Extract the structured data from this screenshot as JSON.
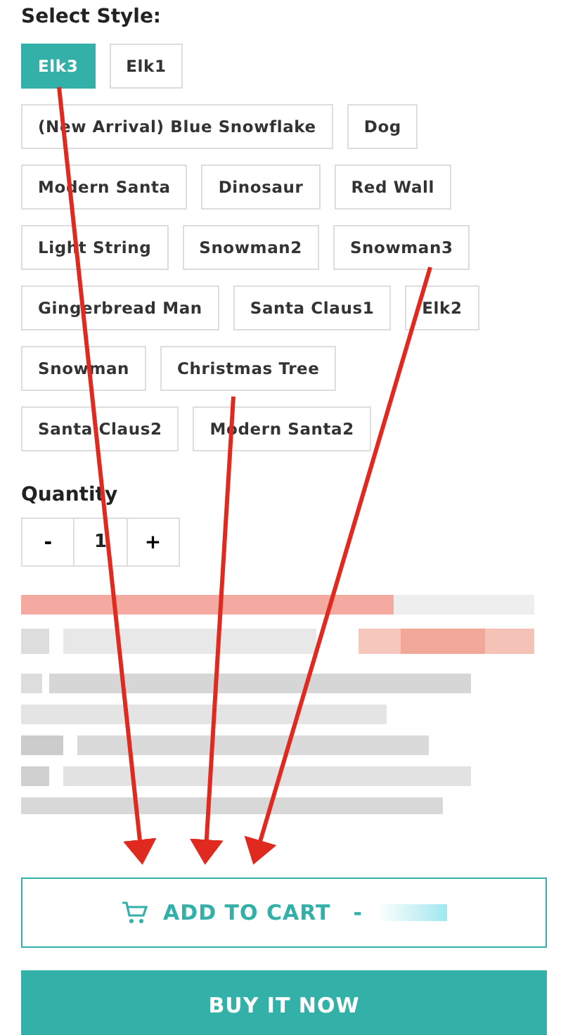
{
  "style_label": "Select Style:",
  "style_rows": [
    [
      {
        "label": "Elk3",
        "selected": true
      },
      {
        "label": "Elk1",
        "selected": false
      }
    ],
    [
      {
        "label": "(New Arrival) Blue Snowflake",
        "selected": false
      },
      {
        "label": "Dog",
        "selected": false
      }
    ],
    [
      {
        "label": "Modern Santa",
        "selected": false
      },
      {
        "label": "Dinosaur",
        "selected": false
      },
      {
        "label": "Red Wall",
        "selected": false
      }
    ],
    [
      {
        "label": "Light String",
        "selected": false
      },
      {
        "label": "Snowman2",
        "selected": false
      },
      {
        "label": "Snowman3",
        "selected": false
      }
    ],
    [
      {
        "label": "Gingerbread Man",
        "selected": false
      },
      {
        "label": "Santa Claus1",
        "selected": false
      },
      {
        "label": "Elk2",
        "selected": false
      }
    ],
    [
      {
        "label": "Snowman",
        "selected": false
      },
      {
        "label": "Christmas Tree",
        "selected": false
      }
    ],
    [
      {
        "label": "Santa Claus2",
        "selected": false
      },
      {
        "label": "Modern Santa2",
        "selected": false
      }
    ]
  ],
  "quantity": {
    "label": "Quantity",
    "minus": "-",
    "value": "1",
    "plus": "+"
  },
  "add_to_cart": {
    "label": "ADD TO CART",
    "separator": "-"
  },
  "buy_now": {
    "label": "BUY IT NOW"
  }
}
